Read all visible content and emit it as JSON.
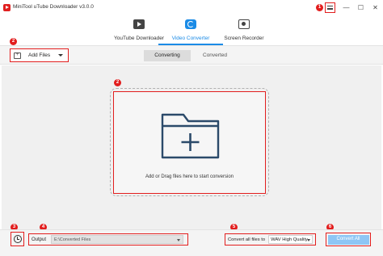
{
  "window": {
    "title": "MiniTool uTube Downloader v3.0.0",
    "minimize": "—",
    "maximize": "☐",
    "close": "✕"
  },
  "nav": {
    "tabs": [
      {
        "label": "YouTube Downloader",
        "icon": "film-icon",
        "active": false
      },
      {
        "label": "Video Converter",
        "icon": "convert-icon",
        "active": true
      },
      {
        "label": "Screen Recorder",
        "icon": "record-icon",
        "active": false
      }
    ]
  },
  "toolbar": {
    "add_files_label": "Add Files",
    "subtabs": [
      "Converting",
      "Converted"
    ],
    "active_subtab": "Converting"
  },
  "drop_zone": {
    "text": "Add or Drag files here to start conversion"
  },
  "bottom": {
    "output_label": "Output",
    "output_path": "E:\\Converted Files",
    "convert_label": "Convert all files to",
    "format_value": "WAV High Quality",
    "convert_all_label": "Convert All"
  },
  "badges": [
    "1",
    "2",
    "2",
    "3",
    "4",
    "5",
    "6"
  ],
  "colors": {
    "accent": "#1b8be6",
    "highlight": "#e21e1e",
    "button_disabled": "#8ec6f5"
  }
}
